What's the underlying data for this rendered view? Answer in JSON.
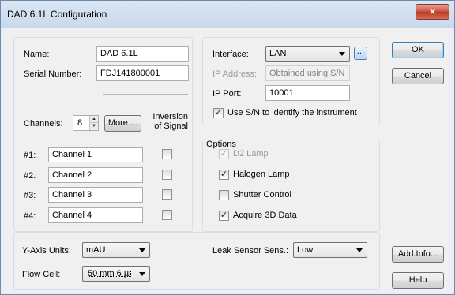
{
  "window": {
    "title": "DAD 6.1L Configuration",
    "close_glyph": "×"
  },
  "identity": {
    "name_label": "Name:",
    "name_value": "DAD 6.1L",
    "serial_label": "Serial Number:",
    "serial_value": "FDJ141800001"
  },
  "channels": {
    "label": "Channels:",
    "count": "8",
    "more_label": "More ...",
    "inversion_label_line1": "Inversion",
    "inversion_label_line2": "of Signal",
    "rows": [
      {
        "id": "#1:",
        "name": "Channel 1",
        "inverted": false
      },
      {
        "id": "#2:",
        "name": "Channel 2",
        "inverted": false
      },
      {
        "id": "#3:",
        "name": "Channel 3",
        "inverted": false
      },
      {
        "id": "#4:",
        "name": "Channel 4",
        "inverted": false
      }
    ]
  },
  "connection": {
    "interface_label": "Interface:",
    "interface_value": "LAN",
    "browse_label": "...",
    "ip_label": "IP Address:",
    "ip_value": "Obtained using S/N",
    "port_label": "IP Port:",
    "port_value": "10001",
    "use_sn_label": "Use S/N to identify the instrument",
    "use_sn_checked": true
  },
  "options": {
    "title": "Options",
    "items": [
      {
        "label": "D2 Lamp",
        "checked": true,
        "enabled": false
      },
      {
        "label": "Halogen Lamp",
        "checked": true,
        "enabled": true
      },
      {
        "label": "Shutter Control",
        "checked": false,
        "enabled": true
      },
      {
        "label": "Acquire 3D Data",
        "checked": true,
        "enabled": true
      }
    ]
  },
  "bottom": {
    "yaxis_label": "Y-Axis Units:",
    "yaxis_value": "mAU",
    "flowcell_label": "Flow Cell:",
    "flowcell_value": "50 mm 6 µl",
    "leak_label": "Leak Sensor Sens.:",
    "leak_value": "Low"
  },
  "buttons": {
    "ok": "OK",
    "cancel": "Cancel",
    "add_info": "Add.Info...",
    "help": "Help"
  }
}
